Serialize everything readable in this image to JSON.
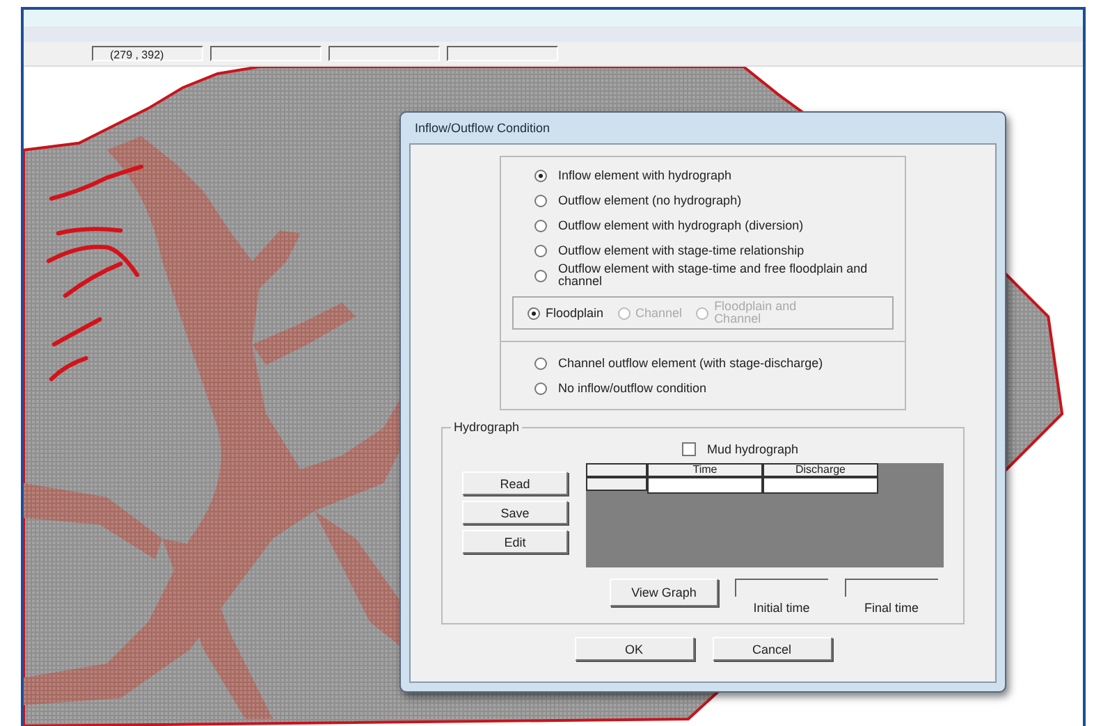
{
  "status_bar": {
    "coordinates": "(279 , 392)"
  },
  "canvas": {
    "kind": "grid-map"
  },
  "dialog": {
    "title": "Inflow/Outflow Condition",
    "options": [
      {
        "label": "Inflow element with hydrograph",
        "selected": true
      },
      {
        "label": "Outflow element (no hydrograph)",
        "selected": false
      },
      {
        "label": "Outflow element with hydrograph (diversion)",
        "selected": false
      },
      {
        "label": "Outflow element with stage-time relationship",
        "selected": false
      },
      {
        "label": "Outflow element with stage-time and free floodplain and channel",
        "selected": false
      }
    ],
    "sub_options": [
      {
        "label": "Floodplain",
        "selected": true,
        "disabled": false
      },
      {
        "label": "Channel",
        "selected": false,
        "disabled": true
      },
      {
        "label": "Floodplain and Channel",
        "selected": false,
        "disabled": true
      }
    ],
    "more_options": [
      {
        "label": "Channel outflow element (with stage-discharge)",
        "selected": false
      },
      {
        "label": "No inflow/outflow condition",
        "selected": false
      }
    ],
    "hydrograph": {
      "title": "Hydrograph",
      "mud": {
        "label": "Mud hydrograph",
        "checked": false
      },
      "buttons": [
        "Read",
        "Save",
        "Edit"
      ],
      "columns": [
        "Time",
        "Discharge"
      ],
      "view_button": "View Graph",
      "initial_label": "Initial time",
      "final_label": "Final time"
    },
    "buttons": [
      "OK",
      "Cancel"
    ]
  }
}
